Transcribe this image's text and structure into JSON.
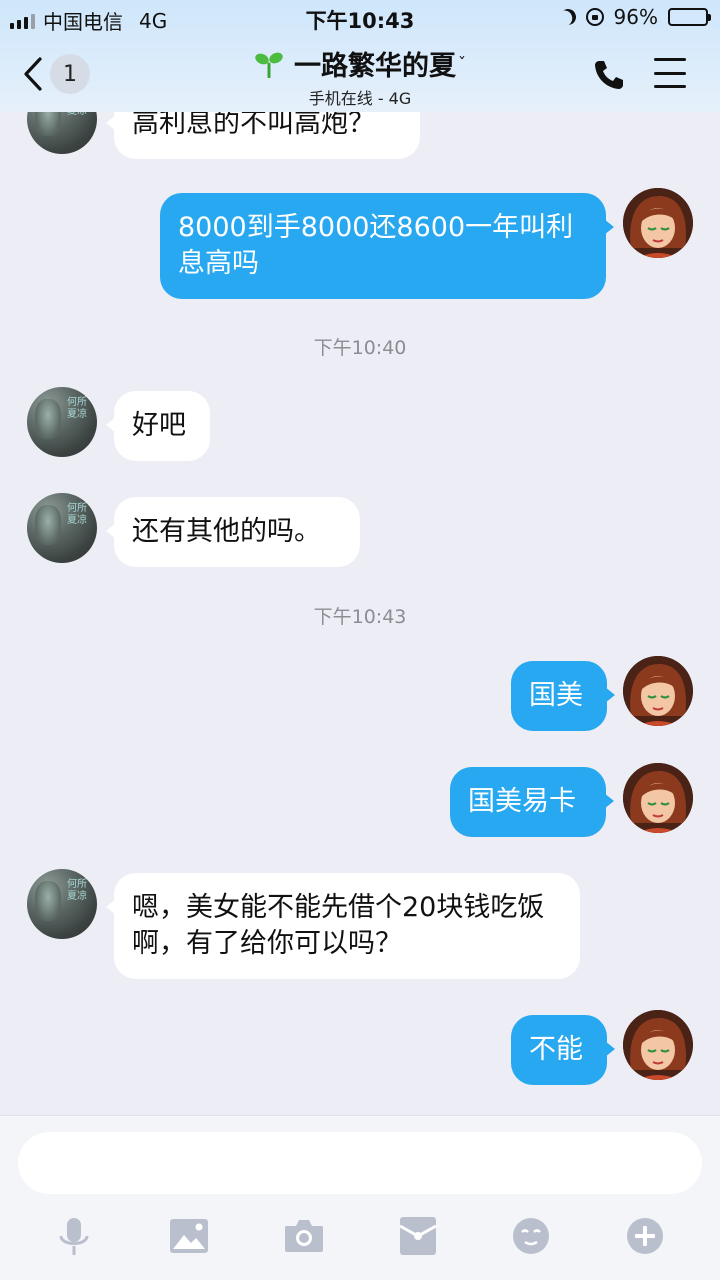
{
  "status_bar": {
    "carrier": "中国电信",
    "network": "4G",
    "time": "下午10:43",
    "battery_percent": "96%",
    "battery_level": 0.96
  },
  "header": {
    "back_count": "1",
    "title": "一路繁华的夏",
    "subtitle": "手机在线 - 4G",
    "icons": [
      "back-chevron-icon",
      "sprout-icon",
      "phone-icon",
      "menu-icon"
    ]
  },
  "messages": [
    {
      "side": "left",
      "text": "高利息的不叫高炮？"
    },
    {
      "side": "right",
      "text": "8000到手8000还8600一年叫利息高吗"
    },
    {
      "side": "time",
      "text": "下午10:40"
    },
    {
      "side": "left",
      "text": "好吧"
    },
    {
      "side": "left",
      "text": "还有其他的吗。"
    },
    {
      "side": "time",
      "text": "下午10:43"
    },
    {
      "side": "right",
      "text": "国美"
    },
    {
      "side": "right",
      "text": "国美易卡"
    },
    {
      "side": "left",
      "text": "嗯，美女能不能先借个20块钱吃饭啊，有了给你可以吗？"
    },
    {
      "side": "right",
      "text": "不能"
    }
  ],
  "avatar_left_text": "何所夏凉",
  "input": {
    "value": "",
    "placeholder": ""
  },
  "toolbar": [
    "microphone-icon",
    "image-icon",
    "camera-icon",
    "red-packet-icon",
    "emoji-icon",
    "plus-icon"
  ],
  "colors": {
    "header_bg": "#d6e9fb",
    "chat_bg": "#edeef5",
    "bubble_right": "#27a8f1",
    "bubble_left": "#ffffff",
    "toolbar_icon": "#b9bfcc"
  }
}
